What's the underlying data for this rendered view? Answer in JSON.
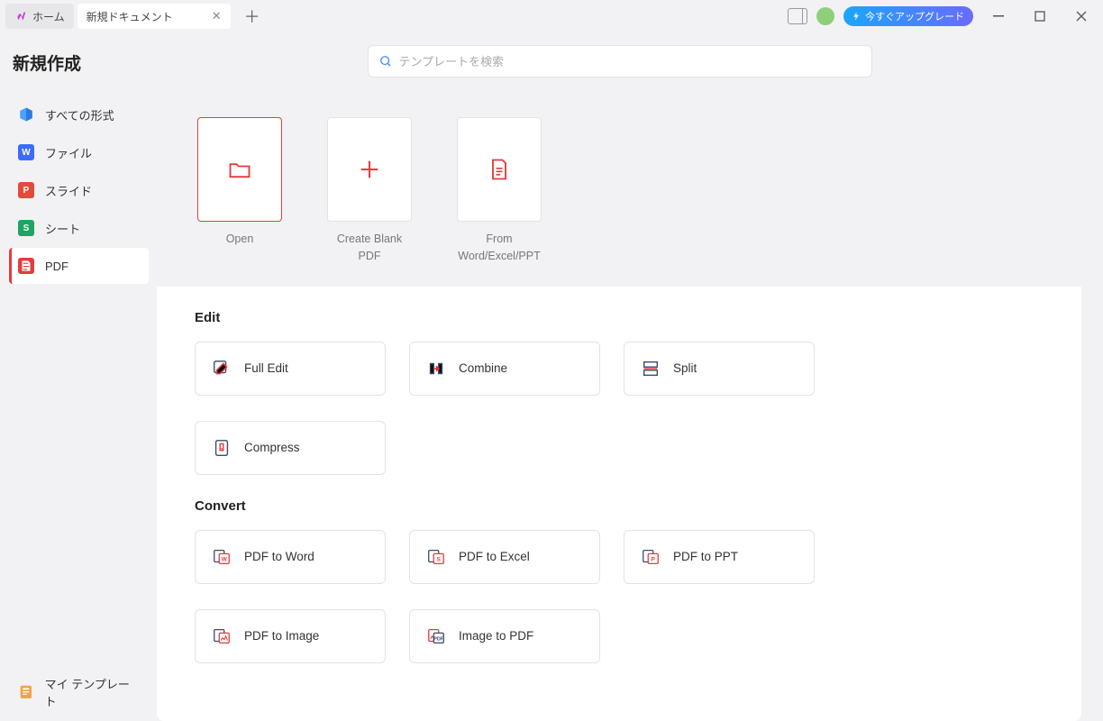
{
  "titlebar": {
    "home_tab": "ホーム",
    "doc_tab": "新規ドキュメント",
    "upgrade": "今すぐアップグレード"
  },
  "sidebar": {
    "title": "新規作成",
    "items": [
      {
        "label": "すべての形式"
      },
      {
        "label": "ファイル"
      },
      {
        "label": "スライド"
      },
      {
        "label": "シート"
      },
      {
        "label": "PDF"
      }
    ],
    "footer": "マイ テンプレート"
  },
  "search": {
    "placeholder": "テンプレートを検索"
  },
  "create": {
    "items": [
      {
        "label": "Open"
      },
      {
        "label": "Create Blank PDF"
      },
      {
        "label": "From Word/Excel/PPT"
      }
    ]
  },
  "sections": {
    "edit": {
      "title": "Edit",
      "tools": [
        {
          "label": "Full Edit"
        },
        {
          "label": "Combine"
        },
        {
          "label": "Split"
        },
        {
          "label": "Compress"
        }
      ]
    },
    "convert": {
      "title": "Convert",
      "tools": [
        {
          "label": "PDF to Word"
        },
        {
          "label": "PDF to Excel"
        },
        {
          "label": "PDF to PPT"
        },
        {
          "label": "PDF to Image"
        },
        {
          "label": "Image to PDF"
        }
      ]
    }
  }
}
